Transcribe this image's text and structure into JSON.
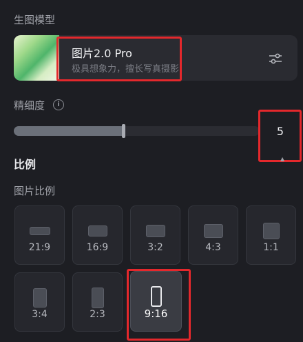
{
  "model_section": {
    "title": "生图模型",
    "card": {
      "name": "图片2.0 Pro",
      "description": "极具想象力，擅长写真摄影",
      "thumbnail_icon": "green-abstract-thumbnail",
      "settings_icon": "sliders-icon"
    }
  },
  "precision": {
    "label": "精细度",
    "info_icon": "info-icon",
    "value": "5",
    "slider_fraction": 0.5
  },
  "ratio_section": {
    "title": "比例",
    "subtitle": "图片比例",
    "options": [
      "21:9",
      "16:9",
      "3:2",
      "4:3",
      "1:1",
      "3:4",
      "2:3",
      "9:16"
    ],
    "selected": "9:16"
  },
  "colors": {
    "background": "#1d1e23",
    "highlight": "#e4282c"
  }
}
